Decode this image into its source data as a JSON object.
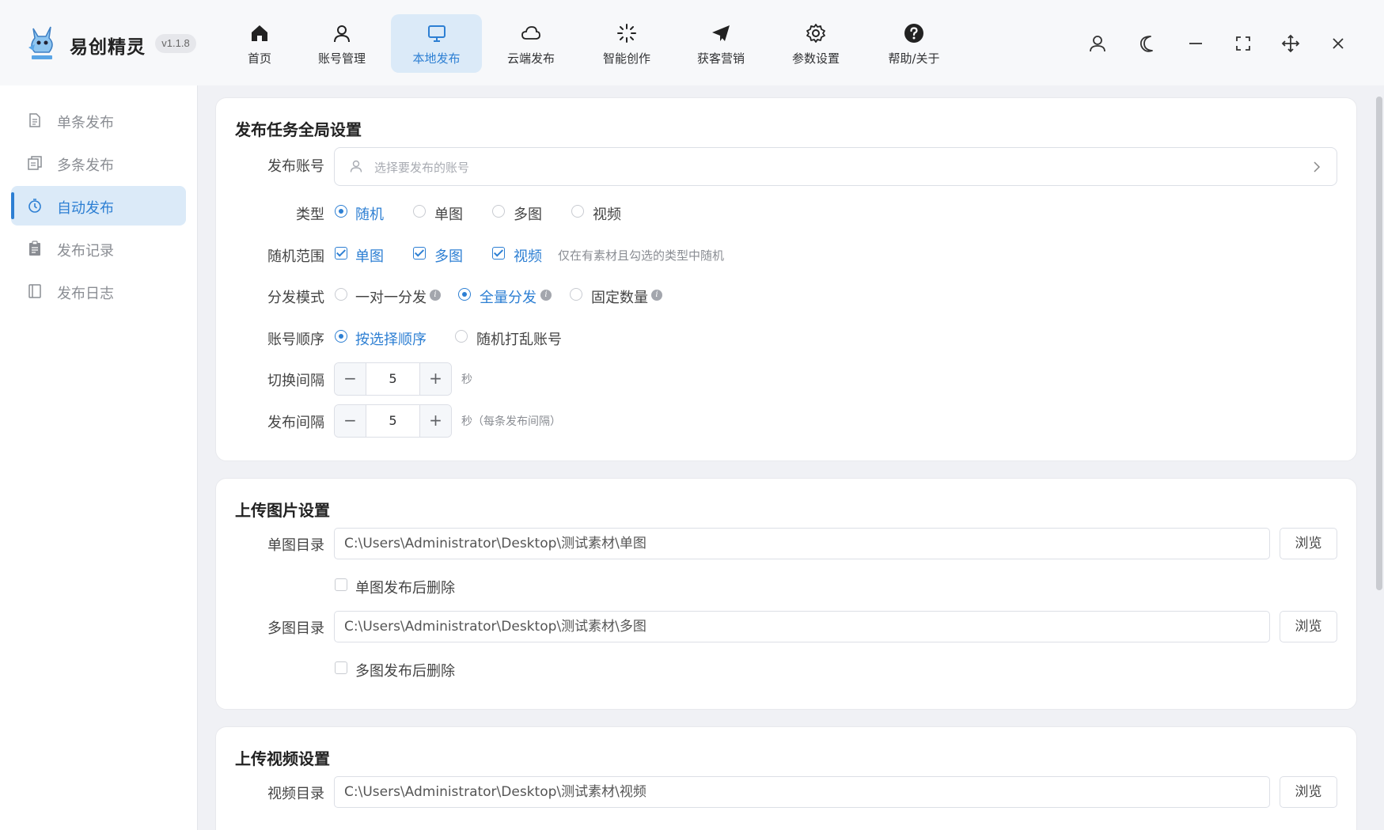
{
  "app": {
    "title": "易创精灵",
    "version": "v1.1.8",
    "accent": "#2d7fd3"
  },
  "nav": [
    {
      "label": "首页",
      "icon": "home-icon"
    },
    {
      "label": "账号管理",
      "icon": "user-icon"
    },
    {
      "label": "本地发布",
      "icon": "monitor-icon",
      "active": true
    },
    {
      "label": "云端发布",
      "icon": "cloud-icon"
    },
    {
      "label": "智能创作",
      "icon": "sparkle-icon"
    },
    {
      "label": "获客营销",
      "icon": "send-icon"
    },
    {
      "label": "参数设置",
      "icon": "gear-icon"
    },
    {
      "label": "帮助/关于",
      "icon": "help-icon"
    }
  ],
  "sidebar": {
    "items": [
      {
        "label": "单条发布",
        "icon": "document-icon"
      },
      {
        "label": "多条发布",
        "icon": "documents-icon"
      },
      {
        "label": "自动发布",
        "icon": "timer-icon",
        "active": true
      },
      {
        "label": "发布记录",
        "icon": "clipboard-icon"
      },
      {
        "label": "发布日志",
        "icon": "book-icon"
      }
    ]
  },
  "global": {
    "title": "发布任务全局设置",
    "account_label": "发布账号",
    "account_placeholder": "选择要发布的账号",
    "type_label": "类型",
    "type_options": [
      "随机",
      "单图",
      "多图",
      "视频"
    ],
    "type_selected": "随机",
    "range_label": "随机范围",
    "range_options": [
      "单图",
      "多图",
      "视频"
    ],
    "range_hint": "仅在有素材且勾选的类型中随机",
    "mode_label": "分发模式",
    "mode_options": [
      "一对一分发",
      "全量分发",
      "固定数量"
    ],
    "mode_selected": "全量分发",
    "order_label": "账号顺序",
    "order_options": [
      "按选择顺序",
      "随机打乱账号"
    ],
    "order_selected": "按选择顺序",
    "switch_label": "切换间隔",
    "switch_value": "5",
    "switch_unit": "秒",
    "publish_label": "发布间隔",
    "publish_value": "5",
    "publish_unit": "秒（每条发布间隔）"
  },
  "images": {
    "title": "上传图片设置",
    "single_label": "单图目录",
    "single_path": "C:\\Users\\Administrator\\Desktop\\测试素材\\单图",
    "single_delete": "单图发布后删除",
    "multi_label": "多图目录",
    "multi_path": "C:\\Users\\Administrator\\Desktop\\测试素材\\多图",
    "multi_delete": "多图发布后删除",
    "browse": "浏览"
  },
  "video": {
    "title": "上传视频设置",
    "dir_label": "视频目录",
    "dir_path": "C:\\Users\\Administrator\\Desktop\\测试素材\\视频",
    "browse": "浏览"
  }
}
